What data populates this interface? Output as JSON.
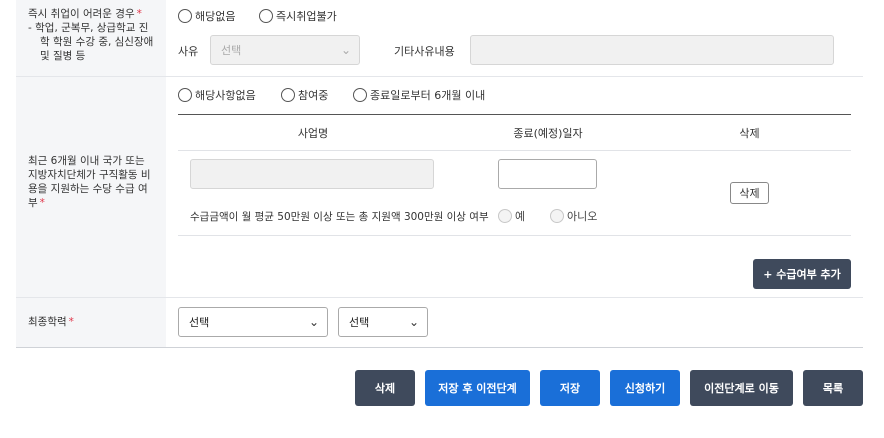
{
  "section1": {
    "label_title": "즉시 취업이 어려운 경우",
    "label_detail": [
      "- 학업, 군복무, 상급학교 진",
      "학 학원 수강 중, 심신장애",
      "및 질병 등"
    ],
    "radios": [
      "해당없음",
      "즉시취업불가"
    ],
    "reason_label": "사유",
    "reason_select": "선택",
    "other_reason_label": "기타사유내용",
    "other_reason_value": ""
  },
  "section2": {
    "label_lines": [
      "최근 6개월 이내 국가 또는",
      "지방자치단체가 구직활동 비",
      "용을 지원하는 수당 수급 여",
      "부"
    ],
    "radios": [
      "해당사항없음",
      "참여중",
      "종료일로부터 6개월 이내"
    ],
    "table_headers": [
      "사업명",
      "종료(예정)일자",
      "삭제"
    ],
    "row": {
      "business_name": "",
      "end_date": "",
      "delete_label": "삭제",
      "question": "수급금액이 월 평균 50만원 이상 또는 총 지원액 300만원 이상 여부",
      "options": [
        "예",
        "아니오"
      ]
    },
    "add_button": "+ 수급여부 추가"
  },
  "section3": {
    "label": "최종학력",
    "select1": "선택",
    "select2": "선택"
  },
  "actions": [
    "삭제",
    "저장 후 이전단계",
    "저장",
    "신청하기",
    "이전단계로 이동",
    "목록"
  ]
}
